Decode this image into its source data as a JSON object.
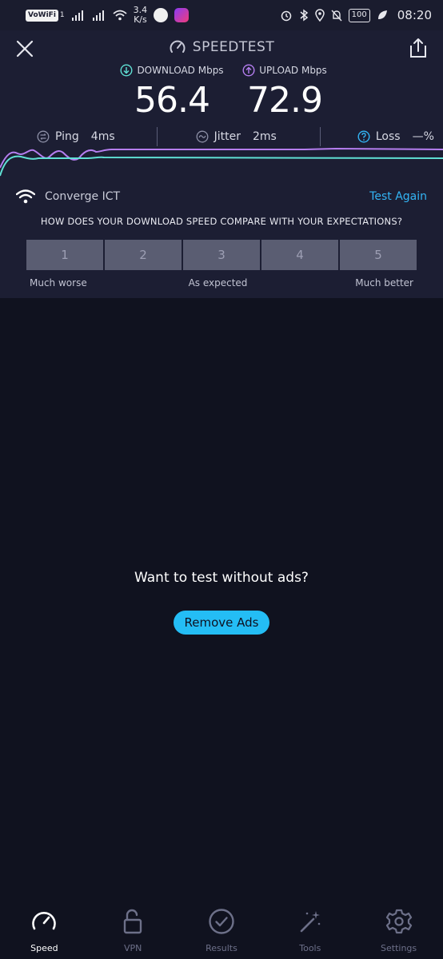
{
  "status_bar": {
    "vowifi": "VoWiFi",
    "vowifi_sub": "1",
    "net_speed_value": "3.4",
    "net_speed_unit": "K/s",
    "battery": "100",
    "time": "08:20"
  },
  "header": {
    "title": "SPEEDTEST"
  },
  "results": {
    "download_label": "DOWNLOAD Mbps",
    "download_value": "56.4",
    "upload_label": "UPLOAD Mbps",
    "upload_value": "72.9",
    "ping_label": "Ping",
    "ping_value": "4ms",
    "jitter_label": "Jitter",
    "jitter_value": "2ms",
    "loss_label": "Loss",
    "loss_value": "—%"
  },
  "isp": {
    "name": "Converge ICT",
    "test_again": "Test Again"
  },
  "survey": {
    "question": "HOW DOES YOUR DOWNLOAD SPEED COMPARE WITH YOUR EXPECTATIONS?",
    "ratings": [
      "1",
      "2",
      "3",
      "4",
      "5"
    ],
    "scale_low": "Much worse",
    "scale_mid": "As expected",
    "scale_high": "Much better"
  },
  "ads": {
    "prompt": "Want to test without ads?",
    "button": "Remove Ads"
  },
  "nav": {
    "items": [
      {
        "label": "Speed",
        "icon": "speedometer-icon",
        "active": true
      },
      {
        "label": "VPN",
        "icon": "unlock-icon",
        "active": false
      },
      {
        "label": "Results",
        "icon": "check-circle-icon",
        "active": false
      },
      {
        "label": "Tools",
        "icon": "magic-wand-icon",
        "active": false
      },
      {
        "label": "Settings",
        "icon": "gear-icon",
        "active": false
      }
    ]
  },
  "colors": {
    "download": "#5fe0d4",
    "upload": "#b57ef0",
    "accent": "#24bdf5",
    "background": "#10121f",
    "card": "#1c1e33"
  }
}
